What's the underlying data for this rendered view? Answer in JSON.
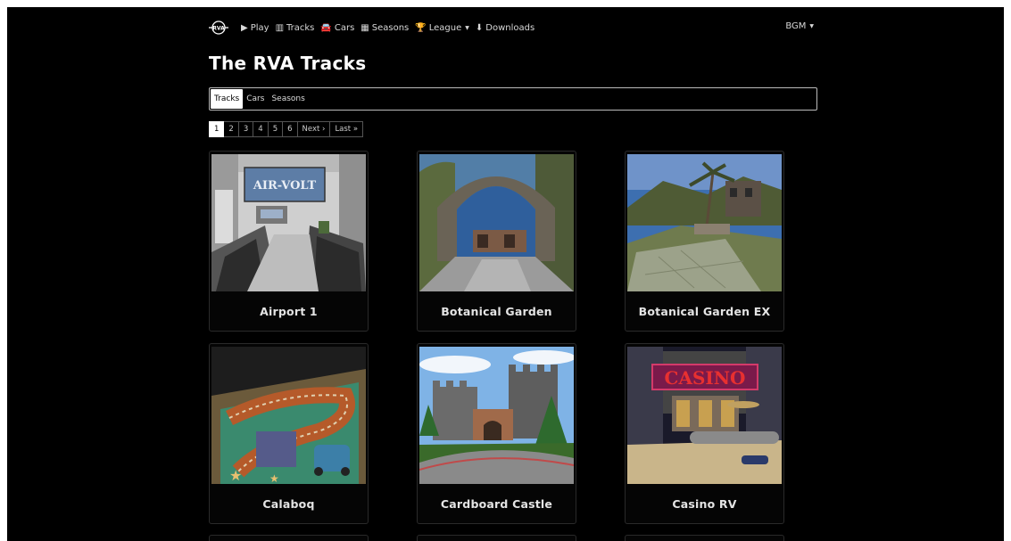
{
  "nav": {
    "logo_text": "RVA",
    "items": [
      {
        "icon": "play-icon",
        "glyph": "▶",
        "label": "Play"
      },
      {
        "icon": "map-icon",
        "glyph": "▥",
        "label": "Tracks"
      },
      {
        "icon": "car-icon",
        "glyph": "🚘",
        "label": "Cars"
      },
      {
        "icon": "calendar-icon",
        "glyph": "▦",
        "label": "Seasons"
      },
      {
        "icon": "trophy-icon",
        "glyph": "🏆",
        "label": "League"
      },
      {
        "icon": "download-icon",
        "glyph": "⬇",
        "label": "Downloads"
      }
    ],
    "user": "BGM"
  },
  "page": {
    "title": "The RVA Tracks"
  },
  "tabs": [
    {
      "label": "Tracks",
      "active": true
    },
    {
      "label": "Cars",
      "active": false
    },
    {
      "label": "Seasons",
      "active": false
    }
  ],
  "pagination": [
    "1",
    "2",
    "3",
    "4",
    "5",
    "6",
    "Next ›",
    "Last »"
  ],
  "tracks": [
    {
      "name": "Airport 1"
    },
    {
      "name": "Botanical Garden"
    },
    {
      "name": "Botanical Garden EX"
    },
    {
      "name": "Calaboq"
    },
    {
      "name": "Cardboard Castle"
    },
    {
      "name": "Casino RV"
    }
  ],
  "thumb_text": {
    "airport": "AIR-VOLT",
    "casino": "CASINO"
  }
}
